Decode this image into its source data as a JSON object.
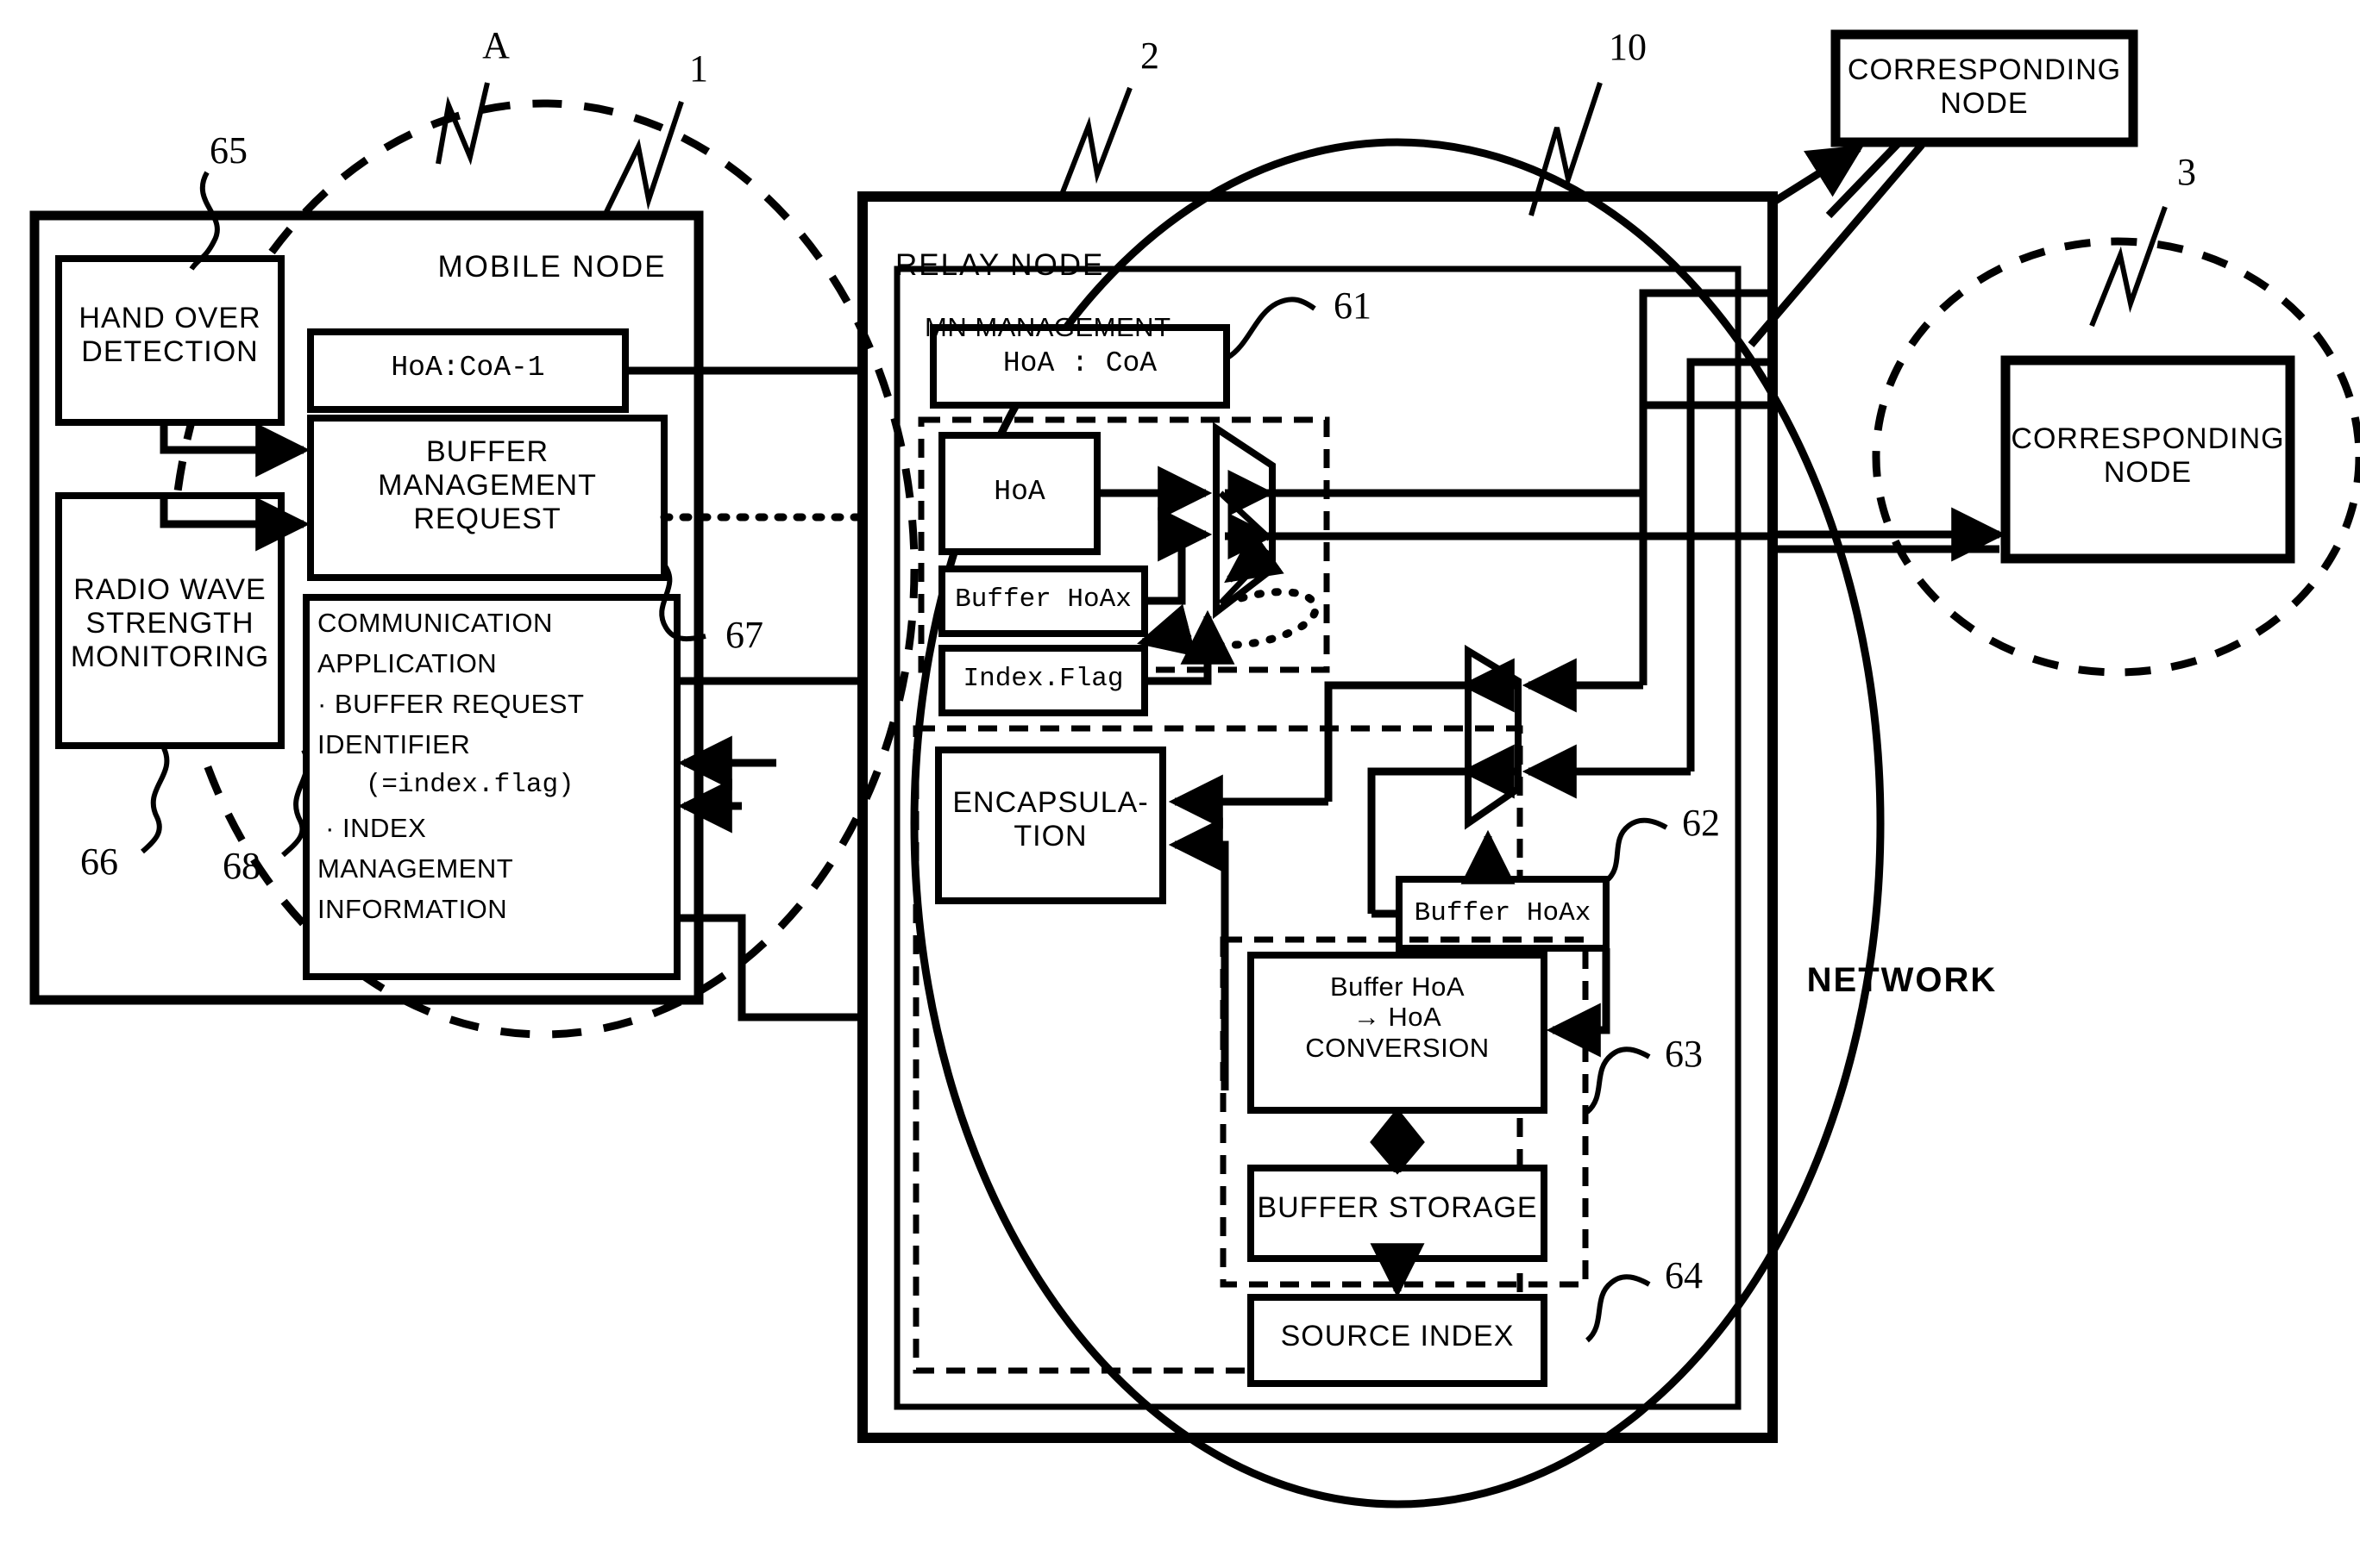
{
  "figure": {
    "network_label": "NETWORK",
    "ellipse_refs": {
      "mobile_area": "A",
      "network": "10",
      "cn_area": "3"
    }
  },
  "mobile_node": {
    "title": "MOBILE NODE",
    "ref": "1",
    "blocks": {
      "handover": {
        "label": "HAND OVER\nDETECTION",
        "ref": "65"
      },
      "radio": {
        "label": "RADIO WAVE\nSTRENGTH\nMONITORING",
        "ref": "66"
      },
      "hoa_coa": {
        "label": "HoA:CoA-1"
      },
      "buffer_mgmt": {
        "label": "BUFFER\nMANAGEMENT\nREQUEST",
        "ref": "67"
      },
      "comm_app": {
        "ref": "68",
        "line1": "COMMUNICATION",
        "line2": "APPLICATION",
        "line3": "· BUFFER REQUEST",
        "line4": "IDENTIFIER",
        "line5": "   (=index.flag)",
        "line6": " · INDEX",
        "line7": "MANAGEMENT",
        "line8": "INFORMATION"
      }
    }
  },
  "relay_node": {
    "title": "RELAY NODE",
    "ref": "2",
    "mn_management": {
      "title": "MN MANAGEMENT",
      "ref": "61",
      "hoa_coa": "HoA : CoA",
      "hoa": "HoA",
      "buffer_hoax": "Buffer HoAx",
      "index_flag": "Index.Flag"
    },
    "encapsulation": {
      "label": "ENCAPSULA-\nTION"
    },
    "buffer_hoax": {
      "label": "Buffer HoAx",
      "ref": "62"
    },
    "conversion": {
      "label": "Buffer HoA\n→ HoA\nCONVERSION",
      "ref": "63"
    },
    "buffer_storage": {
      "label": "BUFFER STORAGE"
    },
    "source_index": {
      "label": "SOURCE INDEX",
      "ref": "64"
    }
  },
  "corresponding_nodes": [
    {
      "label": "CORRESPONDING\nNODE"
    },
    {
      "label": "CORRESPONDING\nNODE",
      "ref": "3"
    }
  ]
}
